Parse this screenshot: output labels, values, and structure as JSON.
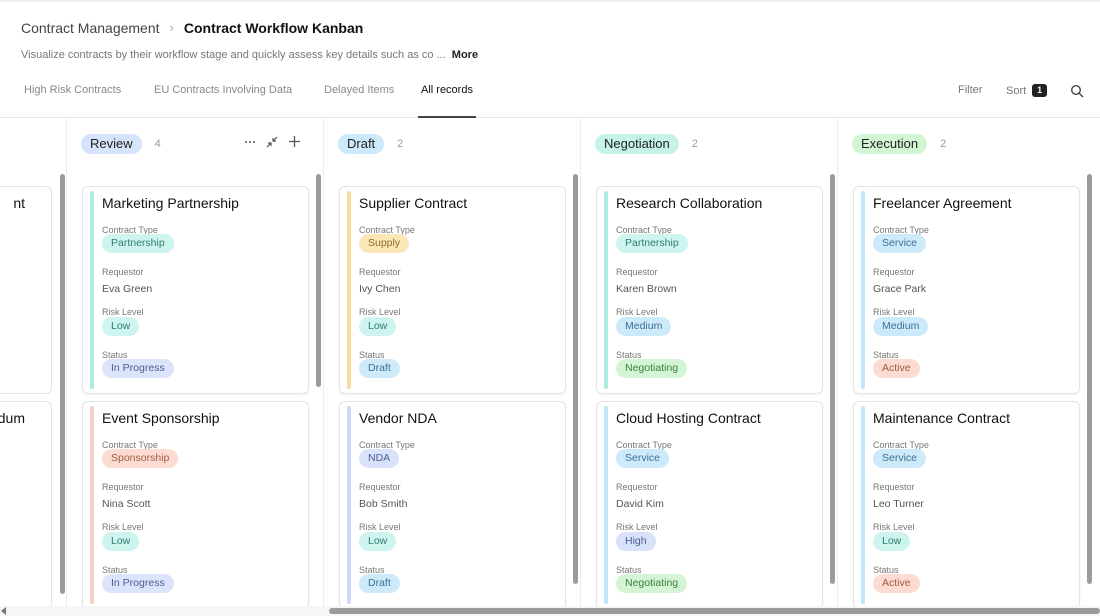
{
  "breadcrumb": {
    "parent": "Contract Management",
    "current": "Contract Workflow Kanban"
  },
  "description": "Visualize contracts by their workflow stage and quickly assess key details such as co ...",
  "more_label": "More",
  "views": [
    {
      "label": "High Risk Contracts"
    },
    {
      "label": "EU Contracts Involving Data"
    },
    {
      "label": "Delayed Items"
    },
    {
      "label": "All records",
      "active": true
    }
  ],
  "toolbar": {
    "filter_label": "Filter",
    "sort_label": "Sort",
    "sort_count": "1",
    "search_icon": "search-icon"
  },
  "field_labels": {
    "contract_type": "Contract Type",
    "requestor": "Requestor",
    "risk_level": "Risk Level",
    "status": "Status"
  },
  "hidden_column": {
    "partial_titles": [
      "nt",
      "dum"
    ]
  },
  "columns": [
    {
      "stage": "Review",
      "count": "4",
      "pill_color": "#d7e3fb",
      "actions": [
        "more-icon",
        "collapse-icon",
        "add-icon"
      ],
      "cards": [
        {
          "title": "Marketing Partnership",
          "accent": "#a8ede0",
          "contract_type": "Partnership",
          "type_bg": "#cdf4ee",
          "type_fg": "#2f7d6f",
          "requestor": "Eva Green",
          "risk": "Low",
          "risk_bg": "#cdf4ee",
          "risk_fg": "#2f7d6f",
          "status": "In Progress",
          "status_bg": "#dbe4fb",
          "status_fg": "#4d5f8f"
        },
        {
          "title": "Event Sponsorship",
          "accent": "#f8cfc3",
          "contract_type": "Sponsorship",
          "type_bg": "#fcdcd2",
          "type_fg": "#a45a45",
          "requestor": "Nina Scott",
          "risk": "Low",
          "risk_bg": "#cdf4ee",
          "risk_fg": "#2f7d6f",
          "status": "In Progress",
          "status_bg": "#dbe4fb",
          "status_fg": "#4d5f8f"
        }
      ]
    },
    {
      "stage": "Draft",
      "count": "2",
      "pill_color": "#cdeafb",
      "cards": [
        {
          "title": "Supplier Contract",
          "accent": "#f9dda3",
          "contract_type": "Supply",
          "type_bg": "#fce7b8",
          "type_fg": "#8a6a25",
          "requestor": "Ivy Chen",
          "risk": "Low",
          "risk_bg": "#cdf4ee",
          "risk_fg": "#2f7d6f",
          "status": "Draft",
          "status_bg": "#cdeafb",
          "status_fg": "#3e6f8f"
        },
        {
          "title": "Vendor NDA",
          "accent": "#cbd8f8",
          "contract_type": "NDA",
          "type_bg": "#d9e2fb",
          "type_fg": "#4d5f8f",
          "requestor": "Bob Smith",
          "risk": "Low",
          "risk_bg": "#cdf4ee",
          "risk_fg": "#2f7d6f",
          "status": "Draft",
          "status_bg": "#cdeafb",
          "status_fg": "#3e6f8f"
        }
      ]
    },
    {
      "stage": "Negotiation",
      "count": "2",
      "pill_color": "#c5f3ea",
      "cards": [
        {
          "title": "Research Collaboration",
          "accent": "#a8ede0",
          "contract_type": "Partnership",
          "type_bg": "#cdf4ee",
          "type_fg": "#2f7d6f",
          "requestor": "Karen Brown",
          "risk": "Medium",
          "risk_bg": "#cdeafb",
          "risk_fg": "#3e6f8f",
          "status": "Negotiating",
          "status_bg": "#d4f5d5",
          "status_fg": "#3f7d42"
        },
        {
          "title": "Cloud Hosting Contract",
          "accent": "#bfe6fa",
          "contract_type": "Service",
          "type_bg": "#cdeafb",
          "type_fg": "#3e6f8f",
          "requestor": "David Kim",
          "risk": "High",
          "risk_bg": "#d9e2fb",
          "risk_fg": "#4d5f8f",
          "status": "Negotiating",
          "status_bg": "#d4f5d5",
          "status_fg": "#3f7d42"
        }
      ]
    },
    {
      "stage": "Execution",
      "count": "2",
      "pill_color": "#d2f5d3",
      "cards": [
        {
          "title": "Freelancer Agreement",
          "accent": "#bfe6fa",
          "contract_type": "Service",
          "type_bg": "#cdeafb",
          "type_fg": "#3e6f8f",
          "requestor": "Grace Park",
          "risk": "Medium",
          "risk_bg": "#cdeafb",
          "risk_fg": "#3e6f8f",
          "status": "Active",
          "status_bg": "#fcdcd2",
          "status_fg": "#a45a45"
        },
        {
          "title": "Maintenance Contract",
          "accent": "#bfe6fa",
          "contract_type": "Service",
          "type_bg": "#cdeafb",
          "type_fg": "#3e6f8f",
          "requestor": "Leo Turner",
          "risk": "Low",
          "risk_bg": "#cdf4ee",
          "risk_fg": "#2f7d6f",
          "status": "Active",
          "status_bg": "#fcdcd2",
          "status_fg": "#a45a45"
        }
      ]
    }
  ]
}
